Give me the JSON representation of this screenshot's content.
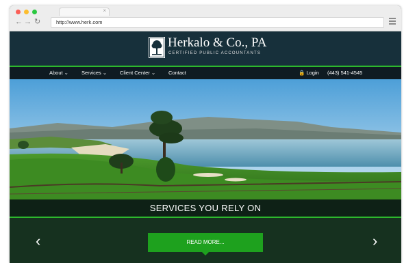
{
  "browser": {
    "url": "http://www.herk.com",
    "icons": {
      "back": "arrow-left-icon",
      "forward": "arrow-right-icon",
      "reload": "reload-icon",
      "menu": "hamburger-menu-icon",
      "tab_close": "close-icon"
    }
  },
  "header": {
    "title": "Herkalo & Co., PA",
    "subtitle": "CERTIFIED PUBLIC ACCOUNTANTS",
    "logo_icon": "tree-logo-icon"
  },
  "nav": {
    "items": [
      {
        "label": "About ⌄"
      },
      {
        "label": "Services ⌄"
      },
      {
        "label": "Client Center ⌄"
      },
      {
        "label": "Contact"
      }
    ],
    "login_label": "🔒 Login",
    "phone": "(443) 541-4545"
  },
  "hero": {
    "caption": "SERVICES YOU RELY ON",
    "button_label": "READ MORE..."
  },
  "colors": {
    "accent": "#2db82d",
    "button": "#1ea11e",
    "header_bg": "#17303b",
    "nav_bg": "#0f1b22"
  }
}
